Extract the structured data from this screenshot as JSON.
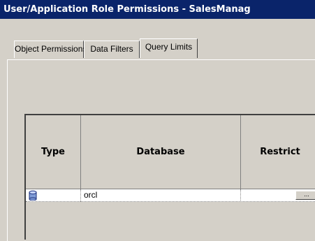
{
  "window": {
    "title": "User/Application Role Permissions - SalesManag"
  },
  "tabs": [
    {
      "label": "Object Permissions",
      "active": false
    },
    {
      "label": "Data Filters",
      "active": false
    },
    {
      "label": "Query Limits",
      "active": true
    }
  ],
  "grid": {
    "columns": [
      "Type",
      "Database",
      "Restrict"
    ],
    "rows": [
      {
        "type_icon": "database-icon",
        "database": "orcl",
        "restrict_button": "..."
      }
    ]
  }
}
